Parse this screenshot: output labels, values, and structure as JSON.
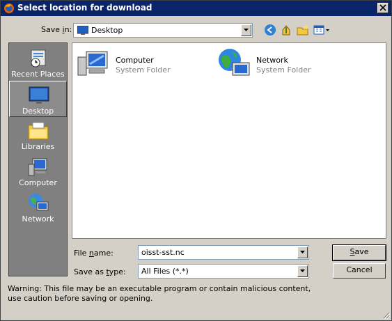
{
  "window": {
    "title": "Select location for download"
  },
  "save_in": {
    "label_prefix": "Save ",
    "label_underlined": "i",
    "label_suffix": "n:",
    "value": "Desktop"
  },
  "toolbar": {
    "back_icon": "back-arrow-icon",
    "up_icon": "up-folder-icon",
    "new_folder_icon": "new-folder-icon",
    "view_icon": "view-menu-icon"
  },
  "places": [
    {
      "label": "Recent Places",
      "icon": "recent-places-icon"
    },
    {
      "label": "Desktop",
      "icon": "desktop-icon",
      "selected": true
    },
    {
      "label": "Libraries",
      "icon": "libraries-icon"
    },
    {
      "label": "Computer",
      "icon": "computer-icon"
    },
    {
      "label": "Network",
      "icon": "network-icon"
    }
  ],
  "items": [
    {
      "name": "Computer",
      "type": "System Folder"
    },
    {
      "name": "Network",
      "type": "System Folder"
    }
  ],
  "file_name": {
    "label_prefix": "File ",
    "label_underlined": "n",
    "label_suffix": "ame:",
    "value": "oisst-sst.nc"
  },
  "save_type": {
    "label_prefix": "Save as ",
    "label_underlined": "t",
    "label_suffix": "ype:",
    "value": "All Files (*.*)"
  },
  "buttons": {
    "save_underlined": "S",
    "save_rest": "ave",
    "cancel": "Cancel"
  },
  "warning": "Warning: This file may be an executable program or contain malicious content, use caution before saving or opening.",
  "colors": {
    "titlebar": "#0a246a",
    "dialog_bg": "#d4d0c8",
    "places_bg": "#808080"
  }
}
